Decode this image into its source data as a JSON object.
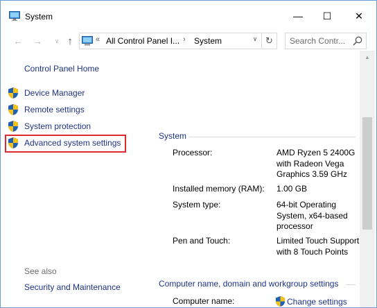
{
  "window": {
    "title": "System",
    "minimize_label": "—",
    "maximize_label": "☐",
    "close_label": "✕"
  },
  "navigation": {
    "back_label": "←",
    "forward_label": "→",
    "recent_label": "∨",
    "up_label": "↑",
    "address_sep": "«",
    "breadcrumb_1": "All Control Panel I...",
    "breadcrumb_sep": "›",
    "breadcrumb_2": "System",
    "dropdown_label": "∨",
    "refresh_label": "↻",
    "search_placeholder": "Search Contr..."
  },
  "sidebar": {
    "home_link": "Control Panel Home",
    "tasks": [
      {
        "label": "Device Manager"
      },
      {
        "label": "Remote settings"
      },
      {
        "label": "System protection"
      },
      {
        "label": "Advanced system settings"
      }
    ],
    "see_also_label": "See also",
    "see_also_links": [
      {
        "label": "Security and Maintenance"
      }
    ]
  },
  "main": {
    "system_section": {
      "title": "System",
      "rows": [
        {
          "label": "Processor:",
          "value": "AMD Ryzen 5 2400G with Radeon Vega Graphics      3.59 GHz"
        },
        {
          "label": "Installed memory (RAM):",
          "value": "1.00 GB"
        },
        {
          "label": "System type:",
          "value": "64-bit Operating System, x64-based processor"
        },
        {
          "label": "Pen and Touch:",
          "value": "Limited Touch Support with 8 Touch Points"
        }
      ]
    },
    "computer_section": {
      "title": "Computer name, domain and workgroup settings",
      "rows": [
        {
          "label": "Computer name:"
        }
      ],
      "change_settings_label": "Change settings"
    }
  },
  "colors": {
    "link": "#1e3287",
    "highlight": "#e0282d",
    "window_border": "#6a9bd8"
  },
  "icons": {
    "app": "system-monitor-icon",
    "shield": "uac-shield-icon",
    "search": "search-icon"
  }
}
